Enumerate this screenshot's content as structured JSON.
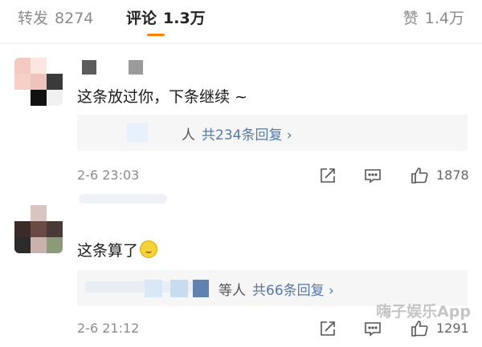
{
  "tabs": {
    "repost": {
      "label": "转发",
      "count": "8274"
    },
    "comments": {
      "label": "评论",
      "count": "1.3万"
    },
    "likes": {
      "label": "赞",
      "count": "1.4万"
    }
  },
  "comments": [
    {
      "text": "这条放过你，下条继续 ~",
      "reply_suffix": "人",
      "reply_link": "共234条回复 ›",
      "time": "2-6 23:03",
      "likes": "1878"
    },
    {
      "text": "这条算了",
      "reply_suffix": "等人",
      "reply_link": "共66条回复 ›",
      "time": "2-6 21:12",
      "likes": "1291"
    }
  ],
  "watermark": "嗨子娱乐App",
  "colors": {
    "accent": "#ff8200",
    "link": "#5578a6",
    "reply_bg": "#f6f6f6"
  }
}
